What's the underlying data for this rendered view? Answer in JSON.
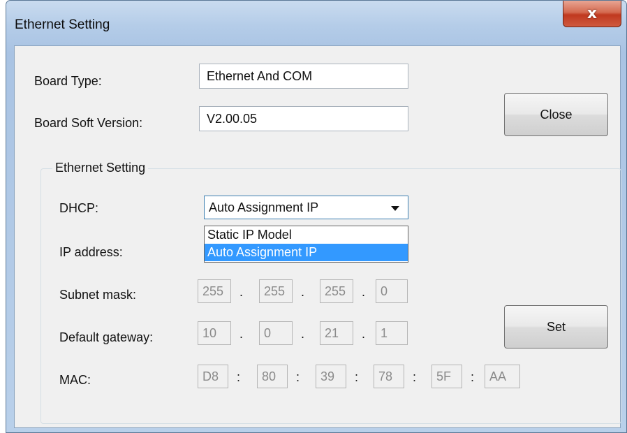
{
  "window": {
    "title": "Ethernet Setting",
    "close_glyph": "x"
  },
  "board": {
    "type_label": "Board Type:",
    "type_value": "Ethernet And COM",
    "version_label": "Board Soft Version:",
    "version_value": "V2.00.05"
  },
  "buttons": {
    "close": "Close",
    "set": "Set"
  },
  "group": {
    "legend": "Ethernet Setting",
    "dhcp_label": "DHCP:",
    "dhcp_selected": "Auto Assignment IP",
    "dhcp_options": [
      "Static IP Model",
      "Auto Assignment IP"
    ],
    "dhcp_highlighted_option": "Auto Assignment IP",
    "ip_label": "IP address:",
    "subnet_label": "Subnet mask:",
    "subnet": [
      "255",
      "255",
      "255",
      "0"
    ],
    "gateway_label": "Default gateway:",
    "gateway": [
      "10",
      "0",
      "21",
      "1"
    ],
    "mac_label": "MAC:",
    "mac": [
      "D8",
      "80",
      "39",
      "78",
      "5F",
      "AA"
    ],
    "ip_separator": ".",
    "mac_separator": ":"
  },
  "colors": {
    "selection": "#3399ff",
    "close_button": "#c0391f"
  },
  "icons": {
    "combo_arrow": "chevron-down-icon",
    "window_close": "close-icon"
  }
}
